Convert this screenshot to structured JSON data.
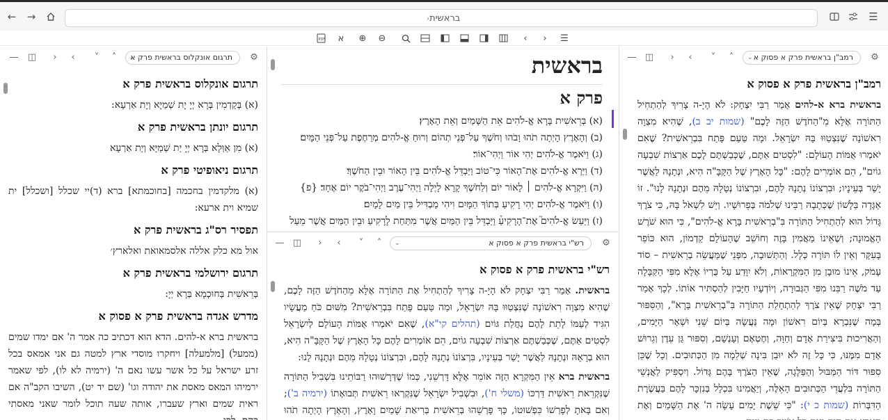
{
  "window": {
    "url_title": "בראשית"
  },
  "left_pane": {
    "select_value": "תרגום אונקלוס בראשית פרק א",
    "sections": [
      {
        "title": "תרגום אונקלוס בראשית פרק א",
        "text": "(א) בְּקַדְמִין בְּרָא יְיָ יָת שְׁמַיָּא וְיָת אַרְעָא:"
      },
      {
        "title": "תרגום יונתן בראשית פרק א",
        "text": "(א) מִן אַוְּלָא בְּרָא יְיָ יַת שְׁמַיָּא וְיַת אַרְעָא"
      },
      {
        "title": "תרגום ניאופיטי פרק א",
        "text": "(א) מלקדמין בחכמה [בחוכמתא] ברא (ד)יי שכלל [ושכלל] ית שמיא וית ארעא:"
      },
      {
        "title": "תפסיר רס\"ג בראשית פרק א",
        "text": "אול מא כלק אללה אלסמאואת ואלארץ׳"
      },
      {
        "title": "תרגום ירושלמי בראשית פרק א",
        "text": "בְּרֵאשִׁית בְּחוּכְמָא בְּרָא יְיָ:"
      },
      {
        "title": "מדרש אגדה בראשית פרק א פסוק א",
        "text": "בראשית ברא א-להים. הדא הוא דכתיב כה אמר ה' אם ימדו שמים (ממעל) [מלמעלה] ויחקרו מוסדי ארץ למטה גם אני אמאס בכל זרע ישראל על כל אשר עשו נאם ה' (ירמיה לא לו), לפי שאמר ירמיהו המאס מאסת את יהודה וגו' (שם יד יט), השיבו הקב\"ה אם ראית שמים וארץ שעברו, אותה שעה תוכל לומר שאני מאסתי בהם. לפי"
      }
    ]
  },
  "center_top": {
    "book_title": "בראשית",
    "chapter_title": "פרק א",
    "verses": [
      "(א) בְּרֵאשִׁית בָּרָא אֱ-לֹהִים אֵת הַשָּׁמַיִם וְאֵת הָאָרֶץ׃",
      "(ב) וְהָאָרֶץ הָיְתָה תֹהוּ וָבֹהוּ וְחֹשֶׁךְ עַל־פְּנֵי תְהוֹם וְרוּחַ אֱ-לֹהִים מְרַחֶפֶת עַל־פְּנֵי הַמָּיִם׃",
      "(ג) וַיֹּאמֶר אֱ-לֹהִים יְהִי אוֹר וַיְהִי־אוֹר׃",
      "(ד) וַיַּרְא אֱ-לֹהִים אֶת־הָאוֹר כִּי־טוֹב וַיַּבְדֵּל אֱ-לֹהִים בֵּין הָאוֹר וּבֵין הַחֹשֶׁךְ׃",
      "(ה) וַיִּקְרָא אֱ-לֹהִים ׀ לָאוֹר יוֹם וְלַחֹשֶׁךְ קָרָא לָיְלָה וַיְהִי־עֶרֶב וַיְהִי־בֹקֶר יוֹם אֶחָד׃ {פ}",
      "(ו) וַיֹּאמֶר אֱ-לֹהִים יְהִי רָקִיעַ בְּתוֹךְ הַמָּיִם וִיהִי מַבְדִּיל בֵּין מַיִם לָמָיִם׃",
      "(ז) וַיַּעַשׂ אֱ-לֹהִים֮ אֶת־הָרָקִיעַ֒ וַיַּבְדֵּל בֵּין הַמַּיִם אֲשֶׁר מִתַּחַת לָרָקִיעַ וּבֵין הַמַּיִם אֲשֶׁר מֵעַל"
    ]
  },
  "center_bottom": {
    "select_value": "רש\"י בראשית פרק א פסוק א",
    "title": "רש\"י בראשית פרק א פסוק א",
    "para1_lead": "בראשית.",
    "para1_a": " אָמַר רַבִּי יִצְחָק לֹא הָיָ-ה צָרִיךְ לְהַתְחִיל אֶת הַתּוֹרָה אֶלָּא מֵהַחֹדֶשׁ הַזֶּה לָכֶם, שֶׁהִיא מִצְוָה רִאשׁוֹנָה שֶׁנִּצְטַוּוּ בָּהּ יִשְׂרָאֵל, וּמַה טַּעַם פָּתַח בִּבְרֵאשִׁית? מִשּׁוּם כֹּחַ מַעֲשָׂיו הִגִּיד לְעַמּוֹ לָתֵת לָהֶם נַחֲלַת גּוֹיִם ",
    "para1_ref": "(תהלים קי\"א)",
    "para1_b": ", שֶׁאִם יֹאמְרוּ אֻמּוֹת הָעוֹלָם לְיִשְׂרָאֵל לִסְטִים אַתֶּם, שֶׁכְּבַשְׁתֶּם אַרְצוֹת שִׁבְעָה גוֹיִם, הֵם אוֹמְרִים לָהֶם כָּל הָאָרֶץ שֶׁל הַקָּבָּ\"ה הִיא, הוּא בְרָאָהּ וּנְתָנָהּ לַאֲשֶׁר יָשַׁר בְּעֵינָיו, בִּרְצוֹנוֹ נְתָנָהּ לָהֶם, וּבִרְצוֹנוֹ נְטָלָהּ מֵהֶם וּנְתָנָהּ לָנוּ:",
    "para2_lead": "בראשית ברא",
    "para2_a": " אֵין הַמִּקְרָא הַזֶּה אוֹמֵר אֶלָּא דָּרְשֵׁנִי, כְּמוֹ שֶׁדְּרָשׁוּהוּ רַבּוֹתֵינוּ בִּשְׁבִיל הַתּוֹרָה שֶׁנִּקְרֵאת רֵאשִׁית דַּרְכּוֹ ",
    "para2_ref1": "(משלי ח')",
    "para2_b": ", וּבִשְׁבִיל יִשְׂרָאֵל שֶׁנִּקְרְאוּ רֵאשִׁית תְּבוּאָתוֹ ",
    "para2_ref2": "(ירמיה ב')",
    "para2_c": "; וְאִם בָּאתָ לְפָרְשׁוֹ כִּפְשׁוּטוֹ, כָּךְ פָּרְשֵׁהוּ בְּרֵאשִׁית בְּרִיאַת שָׁמַיִם וָאָרֶץ, וְהָאָרֶץ הָיְתָה תֹהוּ וָבֹהוּ וְחֹשֶׁךְ"
  },
  "right_pane": {
    "select_value": "רמב\"ן בראשית פרק א פסוק א",
    "title": "רמב\"ן בראשית פרק א פסוק א",
    "lead": "בראשית ברא א-להים",
    "text_a": " אָמַר רַבִּי יִצְחָק: לֹא הָיָ-ה צָרִיךְ לְהַתְחִיל הַתּוֹרָה אֶלָּא מֵ\"הַחֹדֶשׁ הַזֶּה לָכֶם\" ",
    "ref1": "(שמות יב ב)",
    "text_b": ", שֶׁהִיא מִצְוָה רִאשׁוֹנָה שֶׁנִּצְטַוּוּ בָּהּ יִשְׂרָאֵל. וּמָה טַּעַם פָּתַח בִּבְרֵאשִׁית? שֶׁאִם יֹאמְרוּ אֻמּוֹת הָעוֹלָם: \"לִסְטִים אַתֶּם, שֶׁכְּבַשְׁתֶּם לָכֶם אַרְצוֹת שִׁבְעָה גוֹיִם\", הֵם אוֹמְרִים לָהֶם: \"כָּל הָאָרֶץ שֶׁל הַקָּבָּ\"ה הִיא, וּנְתָנָהּ לַאֲשֶׁר יָשַׁר בְּעֵינָיו; וּבִרְצוֹנוֹ נְתָנָהּ לָהֶם, וּבִרְצוֹנוֹ נְטָלָהּ מֵהֶם וּנְתָנָהּ לָנוּ\". זוֹ אַגָּדָה בַּלָּשׁוֹן שֶׁכְּתָבָהּ רַבֵּינוּ שְׁלֹמֹה בְּפֵרוּשָׁיו. וְיֵשׁ לִשְׁאֹל בָּהּ, כִּי צֹרֶךְ גָּדוֹל הוּא לְהַתְחִיל הַתּוֹרָה בִּ\"בְרֵאשִׁית בָּרָא אֱ-לֹהִים\", כִּי הוּא שֹׁרֶשׁ הָאֱמוּנָה; וְשֶׁאֵינוֹ מַאֲמִין בָּזֶה וְחוֹשֵׁב שֶׁהָעוֹלָם קַדְמוֹן, הוּא כּוֹפֵר בָּעִקָּר וְאֵין לוֹ תּוֹרָה כְּלָל. וְהַתְּשׁוּבָה, מִפְּנֵי שֶׁמַּעֲשֵׂה בְרֵאשִׁית – סוֹד עָמֹק, אֵינוֹ מוּבָן מִן הַמִּקְרָאוֹת, וְלֹא יִוָּדַע עַל בֻּרְיוֹ אֶלָּא מִפִּי הַקַּבָּלָה עַד מֹשֶׁה רַבֵּנוּ מִפִּי הַגְּבוּרָה, וְיוֹדְעָיו חַיָּבִין לְהַסְתִּיר אוֹתוֹ. לְכָךְ אָמַר רַבִּי יִצְחָק שֶׁאֵין צֹרֶךְ לְהַתְחָלַת הַתּוֹרָה בִּ\"בְרֵאשִׁית בָּרָא\", וְהַסִּפּוּר בְּמָה שֶׁנִּבְרָא בְּיוֹם רִאשׁוֹן וּמָה נַּעֲשָׂה בְּיוֹם שֵׁנִי וּשְׁאָר הַיָּמִים, וְהַאֲרִיכוּת בִּיצִירַת אָדָם וְחַוָּה, וְחֶטְאָם וְעָנְשָׁם, וְסִפּוּר גַּן עֵדֶן וְגֵרוּשׁ אָדָם מִמֶּנּוּ, כִּי כָּל זֶה לֹא יוּבַן בִּינָה שְׁלֵמָה מִן הַכְּתוּבִים. וְכָל שֶׁכֵּן סִפּוּר דּוֹר הַמַּבּוּל וְהַפַּלָּגָה, שֶׁאֵין הַצֹּרֶךְ בָּהֶם גָּדוֹל. וְיִסְפִּיק לַאֲנְשֵׁי הַתּוֹרָה בִּלְעֲדֵי הַכְּתוּבִים הָאֵלֶּה, וְיַאֲמִינוּ בִּכְלָל בְּנִזְכָּר לָהֶם בַּעֲשֶׂרֶת הַדִּבְּרוֹת ",
    "ref2": "(שמות כ י)",
    "text_c": ": \"כִּי שֵׁשֶׁת יָמִים עָשָׂה ה' אֶת הַשָּׁמַיִם וְאֶת הָאָרֶץ אֶת הַיָּם וְאֶת כָּל אֲשֶׁר בָּם וַיָּנַח"
  },
  "colors": {
    "accent": "#6a3fd0",
    "link": "#3a57c9"
  }
}
